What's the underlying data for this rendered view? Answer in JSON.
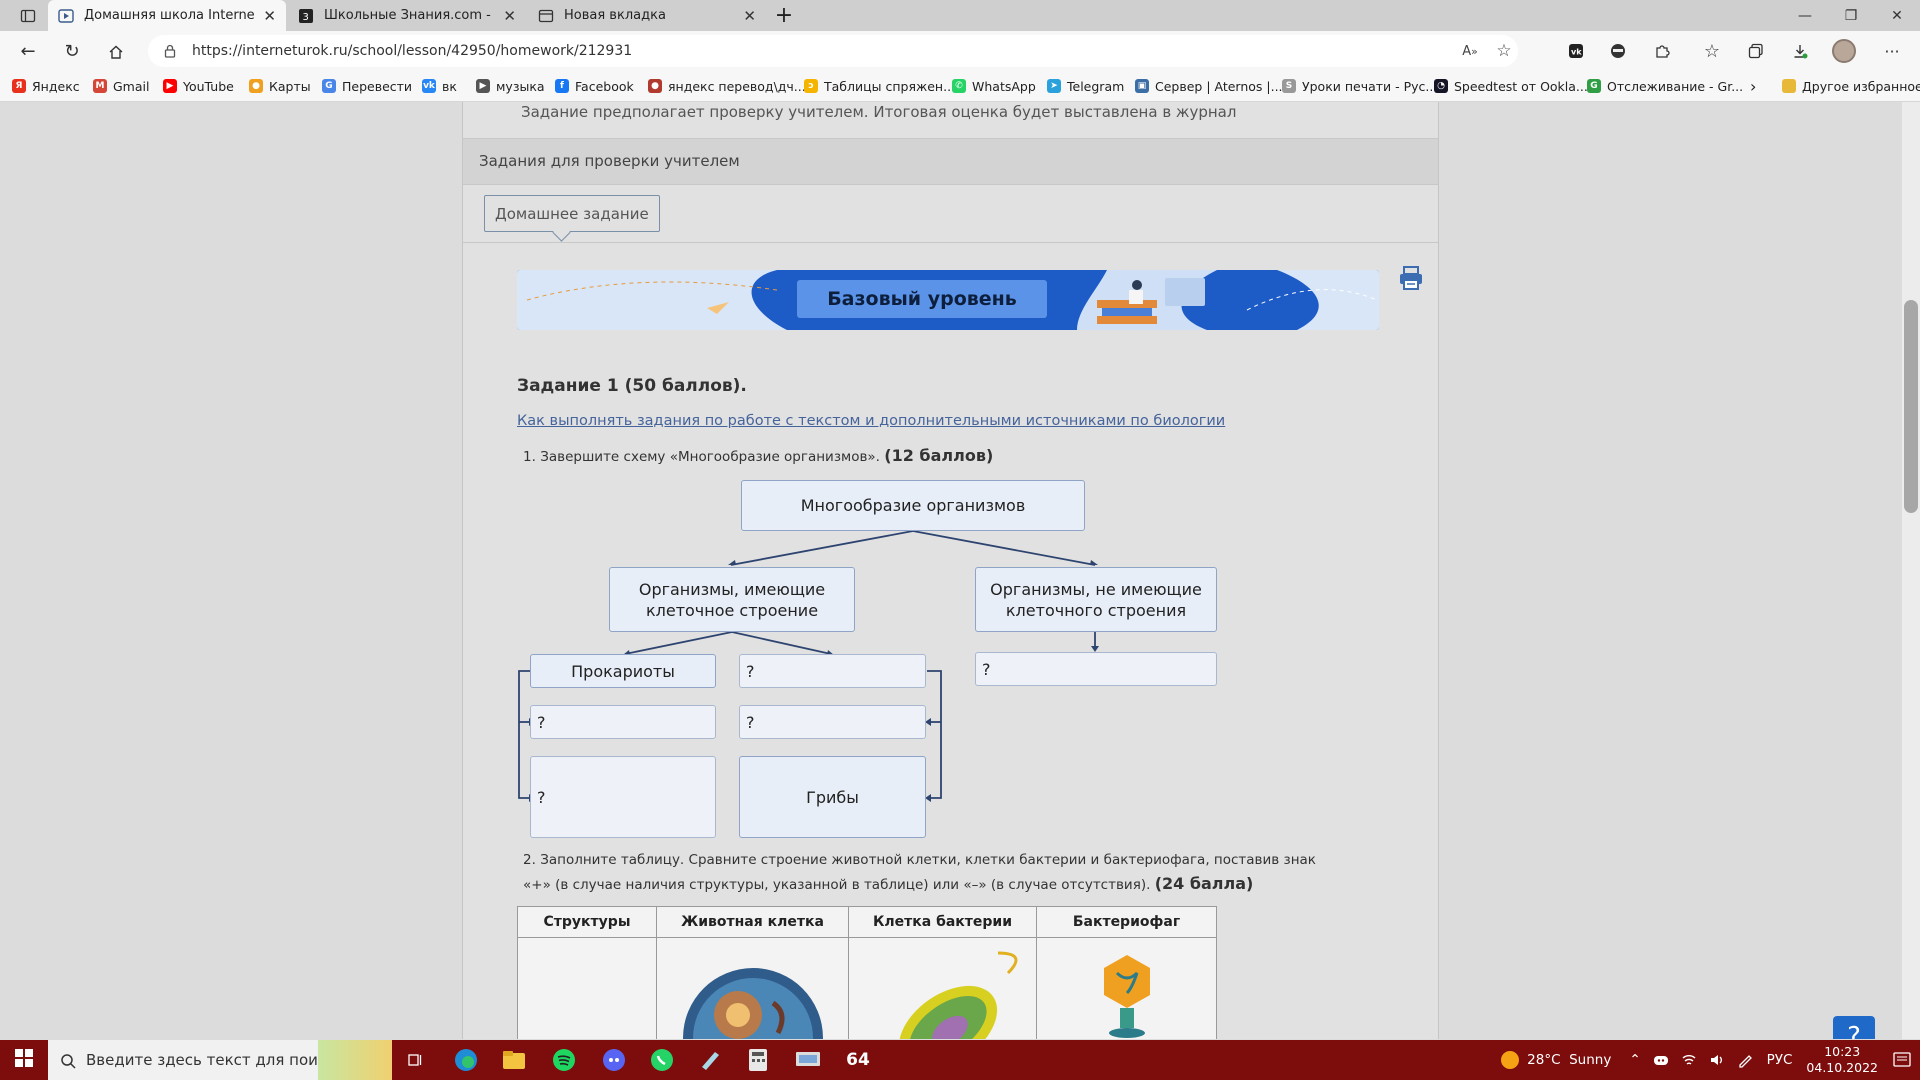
{
  "tabs": [
    {
      "title": "Домашняя школа InternetUrok.r",
      "active": true
    },
    {
      "title": "Школьные Знания.com - Решаем",
      "active": false
    },
    {
      "title": "Новая вкладка",
      "active": false
    }
  ],
  "addressbar": {
    "url": "https://interneturok.ru/school/lesson/42950/homework/212931"
  },
  "bookmarks": [
    {
      "label": "Яндекс",
      "color": "#e8311c",
      "icon": "yandex-icon",
      "glyph": "Я"
    },
    {
      "label": "Gmail",
      "color": "#d44638",
      "icon": "gmail-icon",
      "glyph": "M"
    },
    {
      "label": "YouTube",
      "color": "#ff0000",
      "icon": "youtube-icon",
      "glyph": "▶"
    },
    {
      "label": "Карты",
      "color": "#f0a020",
      "icon": "maps-pin-icon",
      "glyph": "●"
    },
    {
      "label": "Перевести",
      "color": "#4a86e8",
      "icon": "translate-icon",
      "glyph": "G"
    },
    {
      "label": "вк",
      "color": "#2787f5",
      "icon": "vk-icon",
      "glyph": "vk"
    },
    {
      "label": "музыка",
      "color": "#555555",
      "icon": "music-play-icon",
      "glyph": "▶"
    },
    {
      "label": "Facebook",
      "color": "#1877f2",
      "icon": "facebook-icon",
      "glyph": "f"
    },
    {
      "label": "яндекс перевод\\дч...",
      "color": "#b03a2e",
      "icon": "yandex-translate-icon",
      "glyph": "●"
    },
    {
      "label": "Таблицы спряжен...",
      "color": "#f4b400",
      "icon": "conjugation-icon",
      "glyph": "ↄ"
    },
    {
      "label": "WhatsApp",
      "color": "#25d366",
      "icon": "whatsapp-icon",
      "glyph": "✆"
    },
    {
      "label": "Telegram",
      "color": "#2aa1da",
      "icon": "telegram-icon",
      "glyph": "➤"
    },
    {
      "label": "Сервер | Aternos |...",
      "color": "#3a6ea5",
      "icon": "aternos-icon",
      "glyph": "▣"
    },
    {
      "label": "Уроки печати - Рус...",
      "color": "#999999",
      "icon": "typing-icon",
      "glyph": "S"
    },
    {
      "label": "Speedtest от Ookla...",
      "color": "#141526",
      "icon": "speedtest-icon",
      "glyph": "◔"
    },
    {
      "label": "Отслеживание - Gr...",
      "color": "#2f9e44",
      "icon": "tracking-icon",
      "glyph": "G"
    }
  ],
  "bookmarks_other": "Другое избранное",
  "page": {
    "notice": "Задание предполагает проверку учителем. Итоговая оценка будет выставлена в журнал",
    "section_title": "Задания для проверки учителем",
    "homework_tab": "Домашнее задание",
    "banner_label": "Базовый уровень",
    "task1_title": "Задание 1 (50 баллов).",
    "task1_link": "Как выполнять задания по работе с текстом и дополнительными источниками по биологии",
    "q1_num": "1.",
    "q1_text": "Завершите схему «Многообразие организмов».",
    "q1_points": "(12 баллов)",
    "diagram": {
      "root": "Многообразие организмов",
      "left": "Организмы, имеющие клеточное строение",
      "right": "Организмы, не имеющие клеточного строения",
      "prokaryotes": "Прокариоты",
      "fungi": "Грибы",
      "unknown": "?"
    },
    "q2_num": "2.",
    "q2_text": "Заполните таблицу. Сравните строение животной клетки, клетки бактерии и бактериофага, поставив знак «+» (в случае наличия структуры, указанной в таблице) или «–» (в случае отсутствия).",
    "q2_points": "(24 балла)",
    "table_headers": [
      "Структуры",
      "Животная клетка",
      "Клетка бактерии",
      "Бактериофаг"
    ],
    "help_label": "?"
  },
  "taskbar": {
    "search_placeholder": "Введите здесь текст для поиска",
    "weather": "28°C  Sunny",
    "lang": "РУС",
    "time": "10:23",
    "date": "04.10.2022",
    "badge": "64"
  }
}
